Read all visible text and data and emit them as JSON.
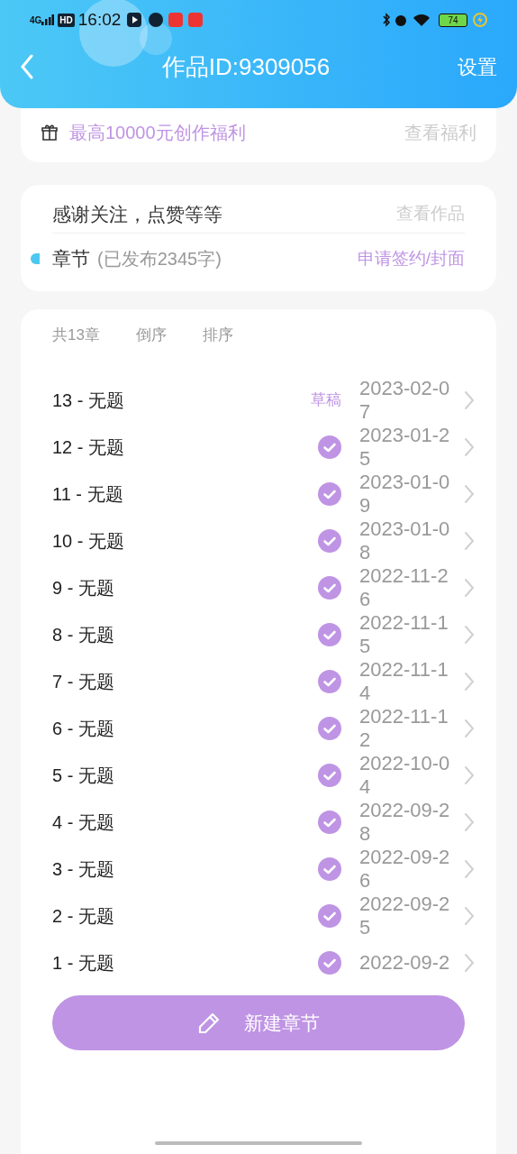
{
  "status_bar": {
    "network": "4G",
    "hd": "HD",
    "time": "16:02",
    "battery": "74"
  },
  "header": {
    "title": "作品ID:9309056",
    "action": "设置"
  },
  "benefit": {
    "text": "最高10000元创作福利",
    "link": "查看福利"
  },
  "work": {
    "description": "感谢关注，点赞等等",
    "link": "查看作品",
    "section": "章节",
    "published": "(已发布2345字)",
    "apply": "申请签约/封面"
  },
  "chapters": {
    "count": "共13章",
    "sort_desc": "倒序",
    "sort": "排序",
    "rows": [
      {
        "title": "13 - 无题",
        "kind": "draft",
        "status_label": "草稿",
        "date": "2023-02-07"
      },
      {
        "title": "12 - 无题",
        "kind": "published",
        "date": "2023-01-25"
      },
      {
        "title": "11 - 无题",
        "kind": "published",
        "date": "2023-01-09"
      },
      {
        "title": "10 - 无题",
        "kind": "published",
        "date": "2023-01-08"
      },
      {
        "title": "9 - 无题",
        "kind": "published",
        "date": "2022-11-26"
      },
      {
        "title": "8 - 无题",
        "kind": "published",
        "date": "2022-11-15"
      },
      {
        "title": "7 - 无题",
        "kind": "published",
        "date": "2022-11-14"
      },
      {
        "title": "6 - 无题",
        "kind": "published",
        "date": "2022-11-12"
      },
      {
        "title": "5 - 无题",
        "kind": "published",
        "date": "2022-10-04"
      },
      {
        "title": "4 - 无题",
        "kind": "published",
        "date": "2022-09-28"
      },
      {
        "title": "3 - 无题",
        "kind": "published",
        "date": "2022-09-26"
      },
      {
        "title": "2 - 无题",
        "kind": "published",
        "date": "2022-09-25"
      },
      {
        "title": "1 - 无题",
        "kind": "published",
        "date": "2022-09-2"
      }
    ]
  },
  "new_chapter": "新建章节"
}
